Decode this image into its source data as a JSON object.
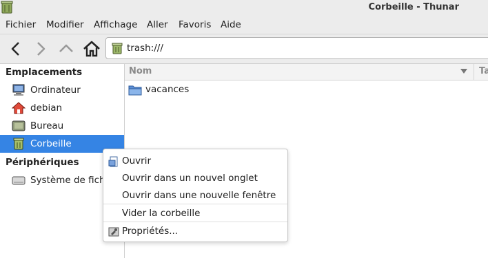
{
  "window": {
    "title": "Corbeille - Thunar"
  },
  "menubar": {
    "items": [
      "Fichier",
      "Modifier",
      "Affichage",
      "Aller",
      "Favoris",
      "Aide"
    ]
  },
  "toolbar": {
    "icons": [
      "back-icon",
      "forward-icon",
      "up-icon",
      "home-icon"
    ],
    "location": "trash:///"
  },
  "sidebar": {
    "places_title": "Emplacements",
    "places": [
      {
        "label": "Ordinateur",
        "icon": "computer-icon"
      },
      {
        "label": "debian",
        "icon": "home-folder-icon"
      },
      {
        "label": "Bureau",
        "icon": "desktop-icon"
      },
      {
        "label": "Corbeille",
        "icon": "trash-icon",
        "selected": true
      }
    ],
    "devices_title": "Périphériques",
    "devices": [
      {
        "label": "Système de fichiers",
        "icon": "drive-icon"
      }
    ]
  },
  "filelist": {
    "column_name": "Nom",
    "column_next": "Ta",
    "files": [
      {
        "name": "vacances",
        "icon": "folder-icon"
      }
    ]
  },
  "context_menu": {
    "open": "Ouvrir",
    "open_tab": "Ouvrir dans un nouvel onglet",
    "open_window": "Ouvrir dans une nouvelle fenêtre",
    "empty_trash": "Vider la corbeille",
    "properties": "Propriétés..."
  },
  "colors": {
    "selection": "#3584e4",
    "chrome": "#ececec"
  }
}
